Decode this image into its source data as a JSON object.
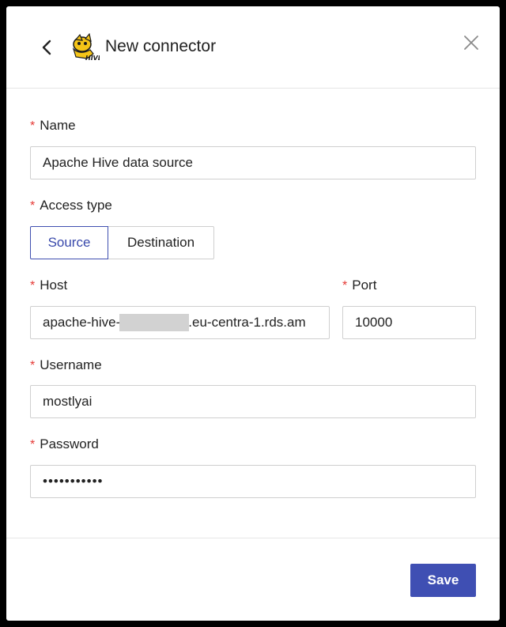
{
  "header": {
    "title": "New connector",
    "back_icon": "chevron-left-icon",
    "logo_icon": "apache-hive-logo",
    "logo_text": "HIVE",
    "close_icon": "close-icon"
  },
  "form": {
    "required_marker": "*",
    "name": {
      "label": "Name",
      "value": "Apache Hive data source"
    },
    "access_type": {
      "label": "Access type",
      "options": [
        "Source",
        "Destination"
      ],
      "selected": "Source"
    },
    "host": {
      "label": "Host",
      "value_prefix": "apache-hive-",
      "value_suffix": ".eu-centra-1.rds.am"
    },
    "port": {
      "label": "Port",
      "value": "10000"
    },
    "username": {
      "label": "Username",
      "value": "mostlyai"
    },
    "password": {
      "label": "Password",
      "value": "•••••••••••"
    }
  },
  "footer": {
    "save_label": "Save"
  },
  "colors": {
    "accent": "#3f4fb3",
    "required": "#e53935",
    "border": "#cfcfcf"
  }
}
